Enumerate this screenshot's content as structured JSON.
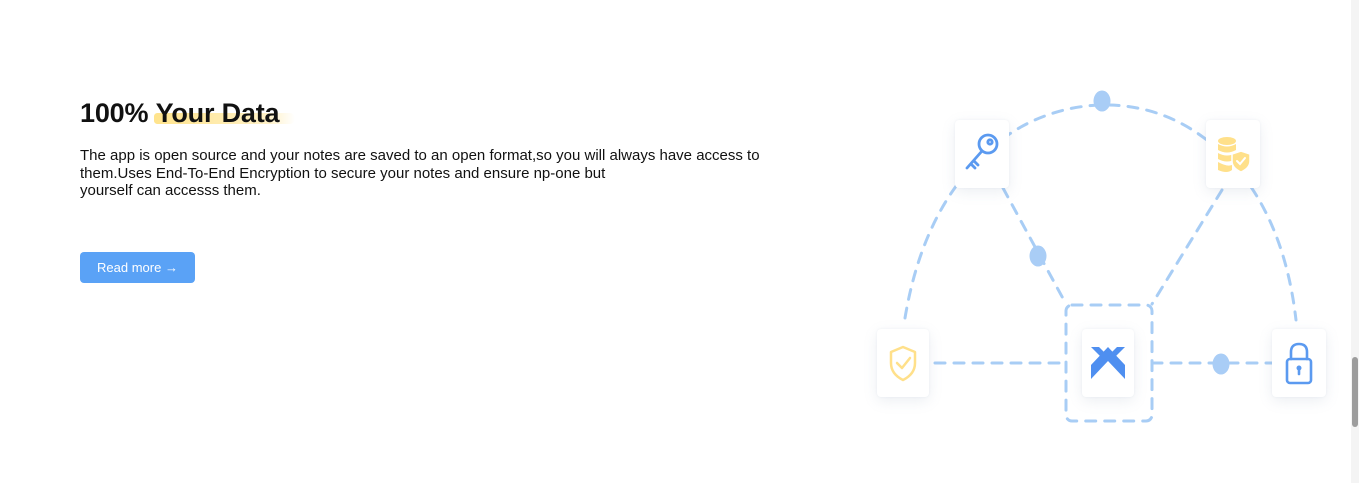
{
  "section": {
    "title_prefix": "100%",
    "title_highlight": "Your Data",
    "description_lines": [
      "The app is open source and your notes are saved to an open format,so you will always have access to",
      "them.Uses End-To-End Encryption to secure your notes and ensure np-one but",
      "yourself can accesss them."
    ],
    "read_more_label": "Read more →"
  },
  "illustration": {
    "icons": [
      "key-icon",
      "database-shield-icon",
      "shield-check-icon",
      "app-logo-icon",
      "padlock-icon"
    ]
  },
  "colors": {
    "accent_blue": "#5aa2f6",
    "line_blue": "#a8cdf5",
    "dot_blue": "#a9cdf6",
    "highlight_yellow": "#ffdf78",
    "icon_yellow": "#ffe08a",
    "icon_blue": "#5b9af0"
  }
}
